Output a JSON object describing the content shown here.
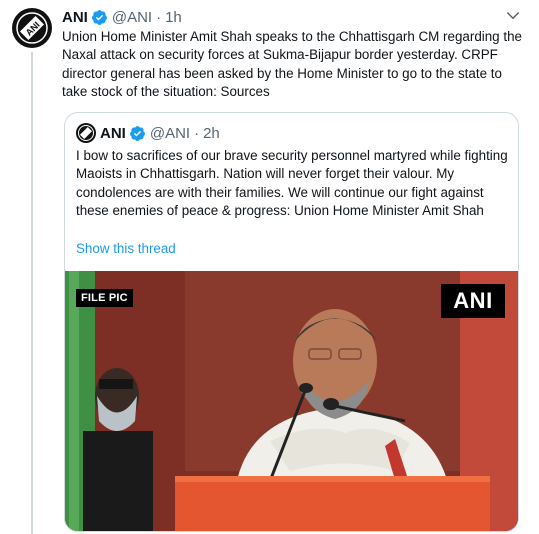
{
  "tweet": {
    "author_name": "ANI",
    "handle": "@ANI",
    "separator": "·",
    "time": "1h",
    "text": "Union Home Minister Amit Shah speaks to the Chhattisgarh CM regarding the Naxal attack on security forces at Sukma-Bijapur border yesterday. CRPF director general has been asked by the Home Minister to go to the state to take stock of the situation: Sources",
    "avatar_text": "ANI"
  },
  "quoted": {
    "author_name": "ANI",
    "handle": "@ANI",
    "separator": "·",
    "time": "2h",
    "text": "I bow to sacrifices of our brave security personnel martyred while fighting Maoists in Chhattisgarh. Nation will never forget their valour. My condolences are with their families. We will continue our fight against these enemies of peace & progress: Union Home Minister Amit Shah",
    "show_thread": "Show this thread",
    "photo": {
      "file_pic_label": "FILE PIC",
      "watermark": "ANI"
    }
  },
  "colors": {
    "accent": "#1d9bf0",
    "text": "#0f1419",
    "secondary": "#536471",
    "border": "#cfd9de"
  },
  "icons": {
    "verified": "verified-badge-icon",
    "more": "more-options-icon"
  }
}
